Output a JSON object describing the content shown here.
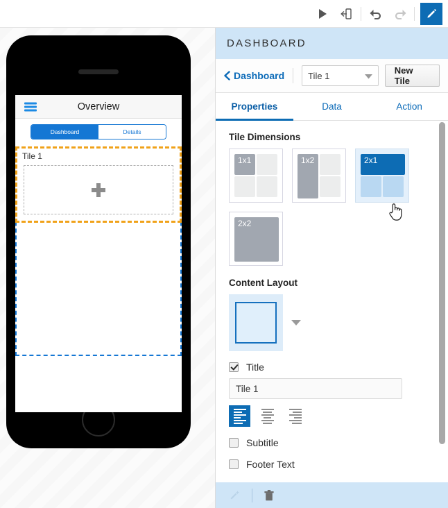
{
  "toolbar": {
    "buttons": [
      {
        "name": "run-icon",
        "label": "Run"
      },
      {
        "name": "export-device-icon",
        "label": "Export"
      },
      {
        "name": "undo-icon",
        "label": "Undo"
      },
      {
        "name": "redo-icon",
        "label": "Redo"
      },
      {
        "name": "edit-pencil-icon",
        "label": "Edit"
      }
    ],
    "accent": "#0d6cb4"
  },
  "preview": {
    "screen_title": "Overview",
    "segmented": [
      {
        "label": "Dashboard",
        "active": true
      },
      {
        "label": "Details",
        "active": false
      }
    ],
    "tile_label": "Tile 1",
    "selection_color": "#f0a21a",
    "container_color": "#1577d4"
  },
  "panel": {
    "title": "DASHBOARD",
    "breadcrumb": {
      "back_label": "Dashboard",
      "select_value": "Tile 1",
      "new_tile_label": "New Tile"
    },
    "tabs": [
      {
        "label": "Properties",
        "active": true
      },
      {
        "label": "Data",
        "active": false
      },
      {
        "label": "Action",
        "active": false
      }
    ],
    "tile_dimensions": {
      "heading": "Tile Dimensions",
      "options": [
        {
          "label": "1x1",
          "selected": false
        },
        {
          "label": "1x2",
          "selected": false
        },
        {
          "label": "2x1",
          "selected": true
        },
        {
          "label": "2x2",
          "selected": false
        }
      ]
    },
    "content_layout": {
      "heading": "Content Layout"
    },
    "title_field": {
      "checkbox_label": "Title",
      "checked": true,
      "value": "Tile 1",
      "alignments": [
        {
          "name": "align-left",
          "active": true
        },
        {
          "name": "align-center",
          "active": false
        },
        {
          "name": "align-right",
          "active": false
        }
      ]
    },
    "subtitle_field": {
      "checkbox_label": "Subtitle",
      "checked": false
    },
    "footer_text_field": {
      "checkbox_label": "Footer Text",
      "checked": false
    }
  },
  "footer": {
    "buttons": [
      {
        "name": "magic-wand-icon",
        "label": "Auto"
      },
      {
        "name": "trash-icon",
        "label": "Delete"
      }
    ]
  }
}
